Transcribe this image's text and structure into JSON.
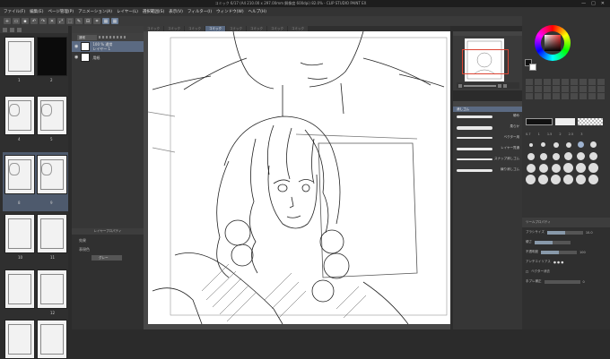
{
  "window": {
    "title": "コミック 6/17 (A4 210.00 x 297.00mm 解像度 600dpi) 82.0% - CLIP STUDIO PAINT EX",
    "controls": [
      "—",
      "□",
      "✕"
    ]
  },
  "menu": [
    "ファイル(F)",
    "編集(E)",
    "ページ管理(P)",
    "アニメーション(A)",
    "レイヤー(L)",
    "選択範囲(S)",
    "表示(V)",
    "フィルター(I)",
    "ウィンドウ(W)",
    "ヘルプ(H)"
  ],
  "toolbar": {
    "icons": [
      "new-page-icon",
      "open-icon",
      "save-icon",
      "undo-icon",
      "redo-icon",
      "clear-icon",
      "transform-icon",
      "select-icon",
      "pen-icon",
      "ruler-icon",
      "snap-icon",
      "grid-icon"
    ]
  },
  "tabs": [
    "コミック",
    "コミック",
    "コミック",
    "コミック",
    "コミック",
    "コミック",
    "コミック",
    "コミック"
  ],
  "active_tab_index": 3,
  "pages": {
    "numbers": [
      "1",
      "2",
      "4",
      "5",
      "8",
      "9",
      "10",
      "11",
      "12"
    ]
  },
  "layers": {
    "blend_mode": "通常",
    "opacity": "100",
    "items": [
      {
        "name": "100 % 通常",
        "sub": "レイヤー 1"
      },
      {
        "name": "用紙",
        "sub": ""
      }
    ],
    "lower_header": "レイヤープロパティ",
    "effect_label": "効果",
    "expression_label": "表現色",
    "expression_value": "グレー"
  },
  "brushes": {
    "header": "ツールプロパティ",
    "selected": "消しゴム",
    "items": [
      "硬め",
      "柔らか",
      "ベクター用",
      "レイヤー貫通",
      "スナップ消しゴム",
      "練り消しゴム"
    ]
  },
  "color": {
    "main": "#111111",
    "sub": "#ffffff",
    "accent": "#5b6a82"
  },
  "brush_sizes": [
    "0.7",
    "1",
    "1.5",
    "2",
    "2.5",
    "3",
    "4",
    "5"
  ],
  "tool_props": {
    "header": "ツールプロパティ",
    "brush_size_label": "ブラシサイズ",
    "brush_size_value": "10.0",
    "hardness_label": "硬さ",
    "opacity_label": "不透明度",
    "opacity_value": "100",
    "antialias_label": "アンチエイリアス",
    "vector_label": "ベクター消去",
    "correction_label": "手ブレ補正",
    "correction_value": "0"
  }
}
